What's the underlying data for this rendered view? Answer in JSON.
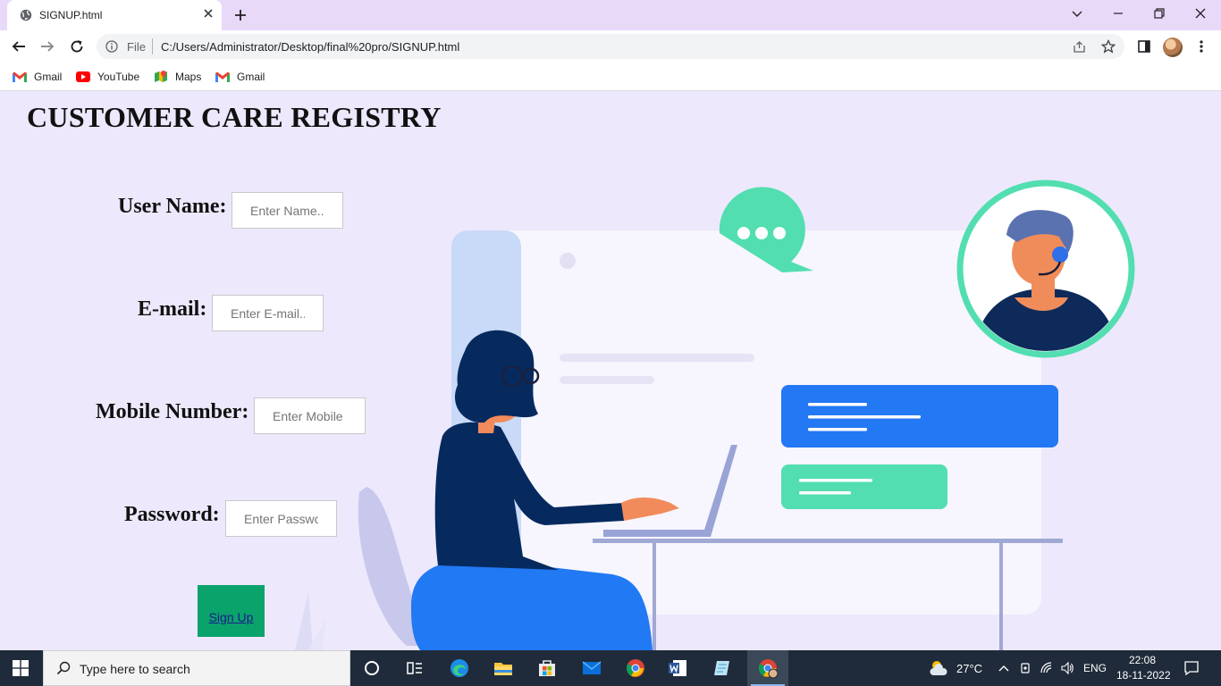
{
  "browser": {
    "tab_title": "SIGNUP.html",
    "scheme_label": "File",
    "url": "C:/Users/Administrator/Desktop/final%20pro/SIGNUP.html",
    "bookmarks": [
      {
        "label": "Gmail",
        "icon": "gmail-icon"
      },
      {
        "label": "YouTube",
        "icon": "youtube-icon"
      },
      {
        "label": "Maps",
        "icon": "maps-icon"
      },
      {
        "label": "Gmail",
        "icon": "gmail-icon"
      }
    ]
  },
  "page": {
    "title": "CUSTOMER CARE REGISTRY",
    "fields": [
      {
        "label": "User Name:",
        "placeholder": "Enter Name..."
      },
      {
        "label": "E-mail:",
        "placeholder": "Enter E-mail..."
      },
      {
        "label": "Mobile Number:",
        "placeholder": "Enter Mobile Number..."
      },
      {
        "label": "Password:",
        "placeholder": "Enter Password..."
      }
    ],
    "submit_label": "Sign Up"
  },
  "taskbar": {
    "search_placeholder": "Type here to search",
    "temperature": "27°C",
    "language": "ENG",
    "time": "22:08",
    "date": "18-11-2022"
  },
  "colors": {
    "page_background": "#ede8fc",
    "signup_button": "#0aa36c",
    "tab_strip": "#e9d9f9",
    "taskbar": "#1f2b3a"
  }
}
